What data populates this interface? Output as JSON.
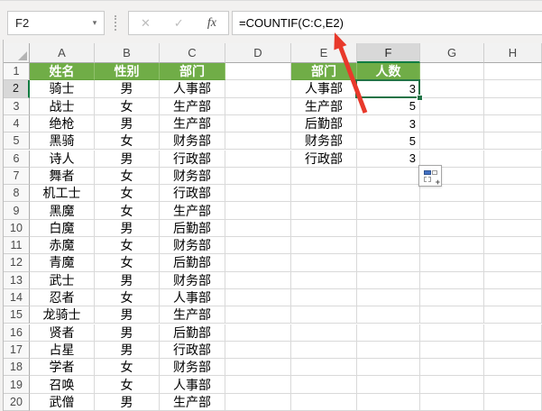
{
  "name_box": {
    "value": "F2"
  },
  "formula_bar": {
    "formula": "=COUNTIF(C:C,E2)"
  },
  "icons": {
    "name_box_dropdown": "▾",
    "cancel": "✕",
    "enter": "✓",
    "fx": "fx",
    "autofill_plus": "+"
  },
  "sheet": {
    "column_letters": [
      "A",
      "B",
      "C",
      "D",
      "E",
      "F",
      "G",
      "H"
    ],
    "row_numbers": [
      "1",
      "2",
      "3",
      "4",
      "5",
      "6",
      "7",
      "8",
      "9",
      "10",
      "11",
      "12",
      "13",
      "14",
      "15",
      "16",
      "17",
      "18",
      "19",
      "20"
    ],
    "selected_cell": "F2",
    "selected_column": "F",
    "selected_row": "2",
    "left_table": {
      "headers": [
        "姓名",
        "性别",
        "部门"
      ],
      "rows": [
        [
          "骑士",
          "男",
          "人事部"
        ],
        [
          "战士",
          "女",
          "生产部"
        ],
        [
          "绝枪",
          "男",
          "生产部"
        ],
        [
          "黑骑",
          "女",
          "财务部"
        ],
        [
          "诗人",
          "男",
          "行政部"
        ],
        [
          "舞者",
          "女",
          "财务部"
        ],
        [
          "机工士",
          "女",
          "行政部"
        ],
        [
          "黑魔",
          "女",
          "生产部"
        ],
        [
          "白魔",
          "男",
          "后勤部"
        ],
        [
          "赤魔",
          "女",
          "财务部"
        ],
        [
          "青魔",
          "女",
          "后勤部"
        ],
        [
          "武士",
          "男",
          "财务部"
        ],
        [
          "忍者",
          "女",
          "人事部"
        ],
        [
          "龙骑士",
          "男",
          "生产部"
        ],
        [
          "贤者",
          "男",
          "后勤部"
        ],
        [
          "占星",
          "男",
          "行政部"
        ],
        [
          "学者",
          "女",
          "财务部"
        ],
        [
          "召唤",
          "女",
          "人事部"
        ],
        [
          "武僧",
          "男",
          "生产部"
        ]
      ]
    },
    "right_table": {
      "headers": [
        "部门",
        "人数"
      ],
      "rows": [
        [
          "人事部",
          "3"
        ],
        [
          "生产部",
          "5"
        ],
        [
          "后勤部",
          "3"
        ],
        [
          "财务部",
          "5"
        ],
        [
          "行政部",
          "3"
        ]
      ]
    }
  },
  "colors": {
    "header_green": "#70AD47",
    "selection_green": "#217346",
    "header_accent_green": "#107C41",
    "arrow_red": "#E8392B",
    "selected_header_gray": "#D8D8D8"
  }
}
